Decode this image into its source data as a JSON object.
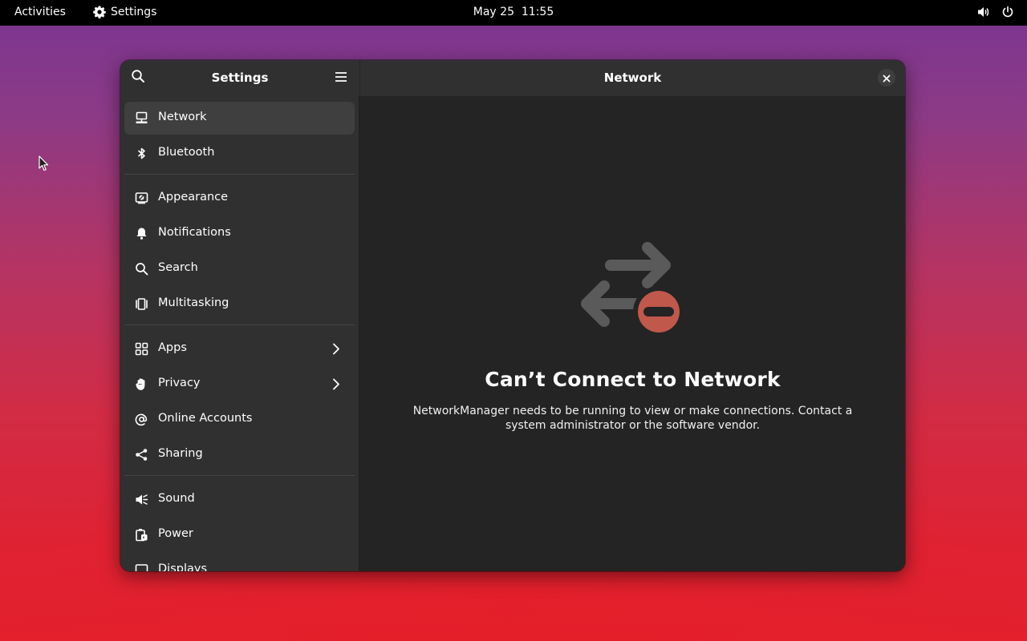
{
  "topbar": {
    "activities": "Activities",
    "app_name": "Settings",
    "app_icon": "gear-icon",
    "clock": "May 25  11:55",
    "status_icons": [
      "volume-icon",
      "power-icon"
    ]
  },
  "window": {
    "sidebar": {
      "title": "Settings",
      "search_icon": "search-icon",
      "menu_icon": "hamburger-menu-icon",
      "groups": [
        [
          {
            "label": "Network",
            "icon": "network-wired-icon",
            "selected": true
          },
          {
            "label": "Bluetooth",
            "icon": "bluetooth-icon"
          }
        ],
        [
          {
            "label": "Appearance",
            "icon": "appearance-icon"
          },
          {
            "label": "Notifications",
            "icon": "bell-icon"
          },
          {
            "label": "Search",
            "icon": "search-icon"
          },
          {
            "label": "Multitasking",
            "icon": "multitasking-icon"
          }
        ],
        [
          {
            "label": "Apps",
            "icon": "apps-grid-icon",
            "chevron": true
          },
          {
            "label": "Privacy",
            "icon": "hand-icon",
            "chevron": true
          },
          {
            "label": "Online Accounts",
            "icon": "at-icon"
          },
          {
            "label": "Sharing",
            "icon": "share-icon"
          }
        ],
        [
          {
            "label": "Sound",
            "icon": "speaker-icon"
          },
          {
            "label": "Power",
            "icon": "battery-icon"
          },
          {
            "label": "Displays",
            "icon": "display-icon"
          }
        ]
      ]
    },
    "content": {
      "title": "Network",
      "close_icon": "close-icon",
      "status_icon": "network-error-icon",
      "status_title": "Can’t Connect to Network",
      "status_description": "NetworkManager needs to be running to view or make connections. Contact a system administrator or the software vendor."
    }
  },
  "colors": {
    "window_bg": "#242424",
    "sidebar_bg": "#303030",
    "selected_row": "#3f3f3f",
    "error_badge": "#c0584b"
  }
}
